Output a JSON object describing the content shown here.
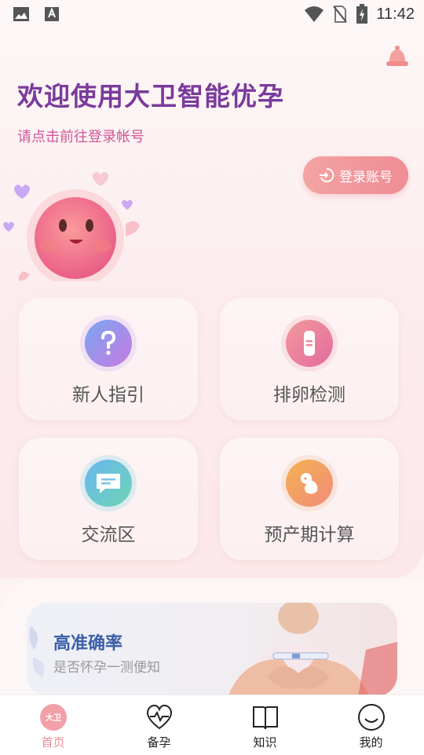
{
  "status_bar": {
    "time": "11:42"
  },
  "header": {
    "title": "欢迎使用大卫智能优孕",
    "subtitle": "请点击前往登录帐号",
    "login_button": "登录账号"
  },
  "menu": [
    {
      "label": "新人指引",
      "icon": "question-icon"
    },
    {
      "label": "排卵检测",
      "icon": "test-strip-icon"
    },
    {
      "label": "交流区",
      "icon": "chat-icon"
    },
    {
      "label": "预产期计算",
      "icon": "baby-icon"
    }
  ],
  "banner": {
    "title": "高准确率",
    "subtitle": "是否怀孕一测便知"
  },
  "tabs": [
    {
      "label": "首页",
      "icon": "home-logo-icon",
      "logo_text": "大卫",
      "active": true
    },
    {
      "label": "备孕",
      "icon": "heart-pulse-icon"
    },
    {
      "label": "知识",
      "icon": "book-icon"
    },
    {
      "label": "我的",
      "icon": "smiley-icon"
    }
  ],
  "colors": {
    "accent": "#ee8b93",
    "title": "#7a3b9c",
    "subtitle": "#d2559a"
  }
}
